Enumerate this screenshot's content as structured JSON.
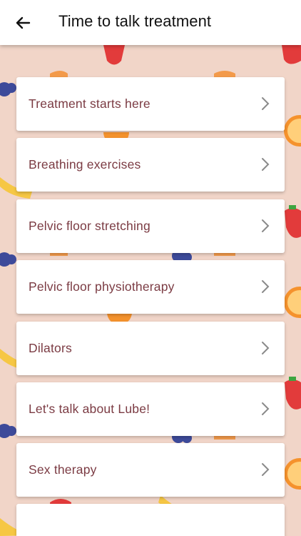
{
  "header": {
    "title": "Time to talk treatment",
    "back_icon": "arrow-left-icon"
  },
  "background": {
    "color": "#f1d5c8",
    "pattern": "fruit-pattern"
  },
  "items": [
    {
      "label": "Treatment starts here"
    },
    {
      "label": "Breathing exercises"
    },
    {
      "label": "Pelvic floor stretching"
    },
    {
      "label": "Pelvic floor physiotherapy"
    },
    {
      "label": "Dilators"
    },
    {
      "label": "Let's talk about Lube!"
    },
    {
      "label": "Sex therapy"
    },
    {
      "label": ""
    }
  ],
  "colors": {
    "item_text": "#7b3b43",
    "chevron": "#8a8a8a"
  }
}
